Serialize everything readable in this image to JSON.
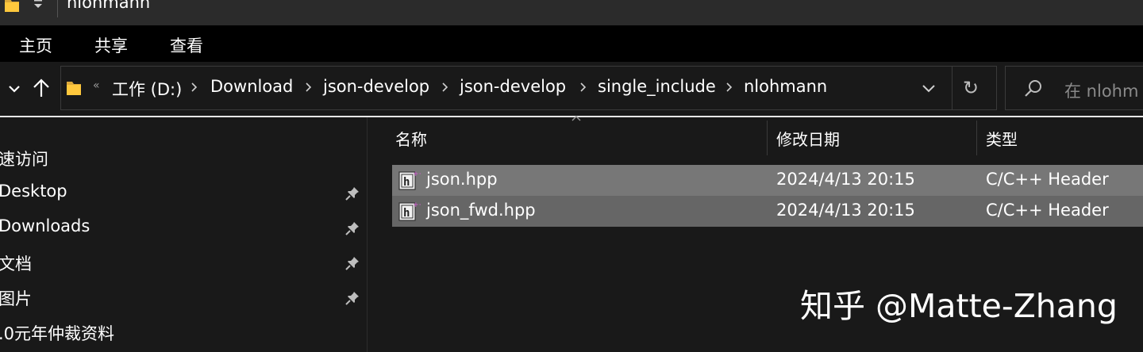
{
  "window": {
    "title": "nlohmann"
  },
  "ribbon": {
    "tabs": [
      "主页",
      "共享",
      "查看"
    ]
  },
  "address": {
    "overflow": "«",
    "crumbs": [
      "工作 (D:)",
      "Download",
      "json-develop",
      "json-develop",
      "single_include",
      "nlohmann"
    ],
    "refresh": "↻"
  },
  "search": {
    "placeholder": "在 nlohmann 中搜索"
  },
  "search_visible": "在 nlohm",
  "sidebar": {
    "items": [
      {
        "label": "速访问",
        "pinned": false
      },
      {
        "label": "Desktop",
        "pinned": true
      },
      {
        "label": "Downloads",
        "pinned": true
      },
      {
        "label": "文档",
        "pinned": true
      },
      {
        "label": "图片",
        "pinned": true
      },
      {
        "label": ".0元年仲裁资料",
        "pinned": false
      }
    ]
  },
  "columns": {
    "name": "名称",
    "date": "修改日期",
    "type": "类型"
  },
  "files": [
    {
      "name": "json.hpp",
      "modified": "2024/4/13 20:15",
      "type": "C/C++ Header",
      "icon": "cpp-header-file-icon"
    },
    {
      "name": "json_fwd.hpp",
      "modified": "2024/4/13 20:15",
      "type": "C/C++ Header",
      "icon": "cpp-header-file-icon"
    }
  ],
  "watermark": "知乎 @Matte-Zhang",
  "colors": {
    "folder": "#ffc83d",
    "selection": "#777777",
    "background": "#191919"
  }
}
